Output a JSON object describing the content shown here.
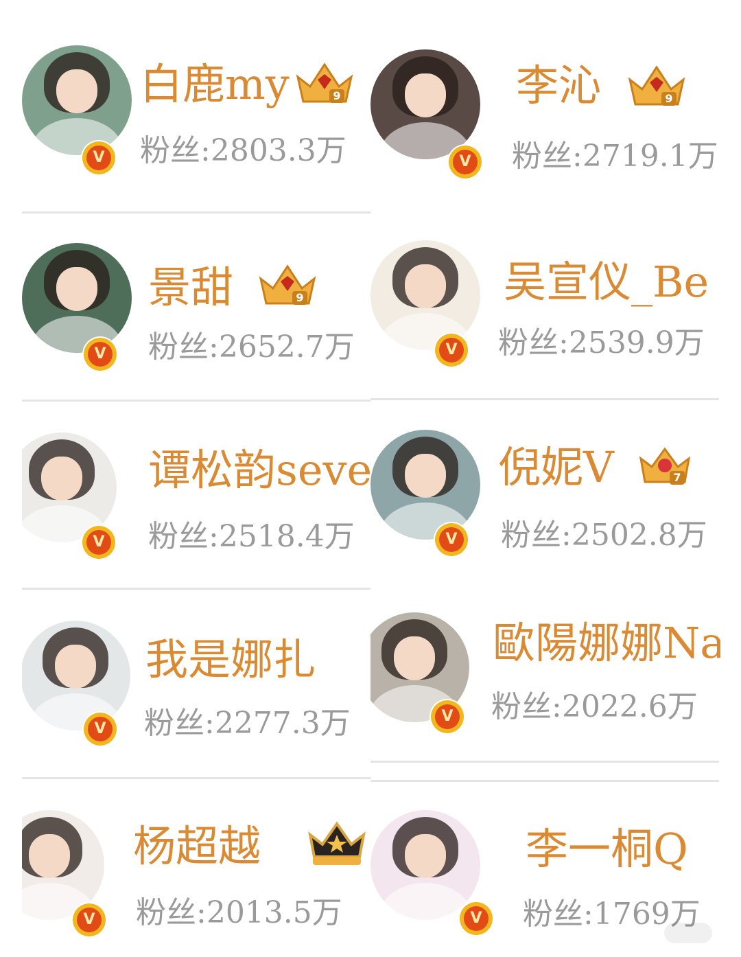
{
  "profiles": [
    {
      "name": "白鹿my",
      "fans_label": "粉丝:",
      "fans_value": "2803.3万",
      "crown": "crown-level-9",
      "crown_level": "9",
      "avatar_bg": "#7fa08c",
      "verified_icon": "verified-v-icon"
    },
    {
      "name": "李沁",
      "fans_label": "粉丝:",
      "fans_value": "2719.1万",
      "crown": "crown-level-9",
      "crown_level": "9",
      "avatar_bg": "#5a4a45",
      "verified_icon": "verified-v-icon"
    },
    {
      "name": "景甜",
      "fans_label": "粉丝:",
      "fans_value": "2652.7万",
      "crown": "crown-level-9",
      "crown_level": "9",
      "avatar_bg": "#4f6e5a",
      "verified_icon": "verified-v-icon"
    },
    {
      "name": "吴宣仪_Be",
      "fans_label": "粉丝:",
      "fans_value": "2539.9万",
      "crown": "",
      "crown_level": "",
      "avatar_bg": "#f2ece2",
      "verified_icon": "verified-v-icon"
    },
    {
      "name": "谭松韵seve",
      "fans_label": "粉丝:",
      "fans_value": "2518.4万",
      "crown": "",
      "crown_level": "",
      "avatar_bg": "#ecebe8",
      "verified_icon": "verified-v-icon"
    },
    {
      "name": "倪妮V",
      "fans_label": "粉丝:",
      "fans_value": "2502.8万",
      "crown": "crown-level-7",
      "crown_level": "7",
      "avatar_bg": "#8fa6a8",
      "verified_icon": "verified-v-icon"
    },
    {
      "name": "我是娜扎",
      "fans_label": "粉丝:",
      "fans_value": "2277.3万",
      "crown": "",
      "crown_level": "",
      "avatar_bg": "#e3e7e8",
      "verified_icon": "verified-v-icon"
    },
    {
      "name": "歐陽娜娜Na",
      "fans_label": "粉丝:",
      "fans_value": "2022.6万",
      "crown": "",
      "crown_level": "",
      "avatar_bg": "#b9b2a8",
      "verified_icon": "verified-v-icon"
    },
    {
      "name": "杨超越",
      "fans_label": "粉丝:",
      "fans_value": "2013.5万",
      "crown": "crown-black-star",
      "crown_level": "",
      "avatar_bg": "#f1ece8",
      "verified_icon": "verified-v-icon"
    },
    {
      "name": "李一桐Q",
      "fans_label": "粉丝:",
      "fans_value": "1769万",
      "crown": "",
      "crown_level": "",
      "avatar_bg": "#f4e6ee",
      "verified_icon": "verified-v-icon"
    }
  ],
  "colors": {
    "name": "#d98a33",
    "fans": "#9a9a9a",
    "divider": "#e4e4e4",
    "badge_outer": "#f2b61e",
    "badge_inner": "#e24a16",
    "crown_gold": "#f0b040"
  }
}
